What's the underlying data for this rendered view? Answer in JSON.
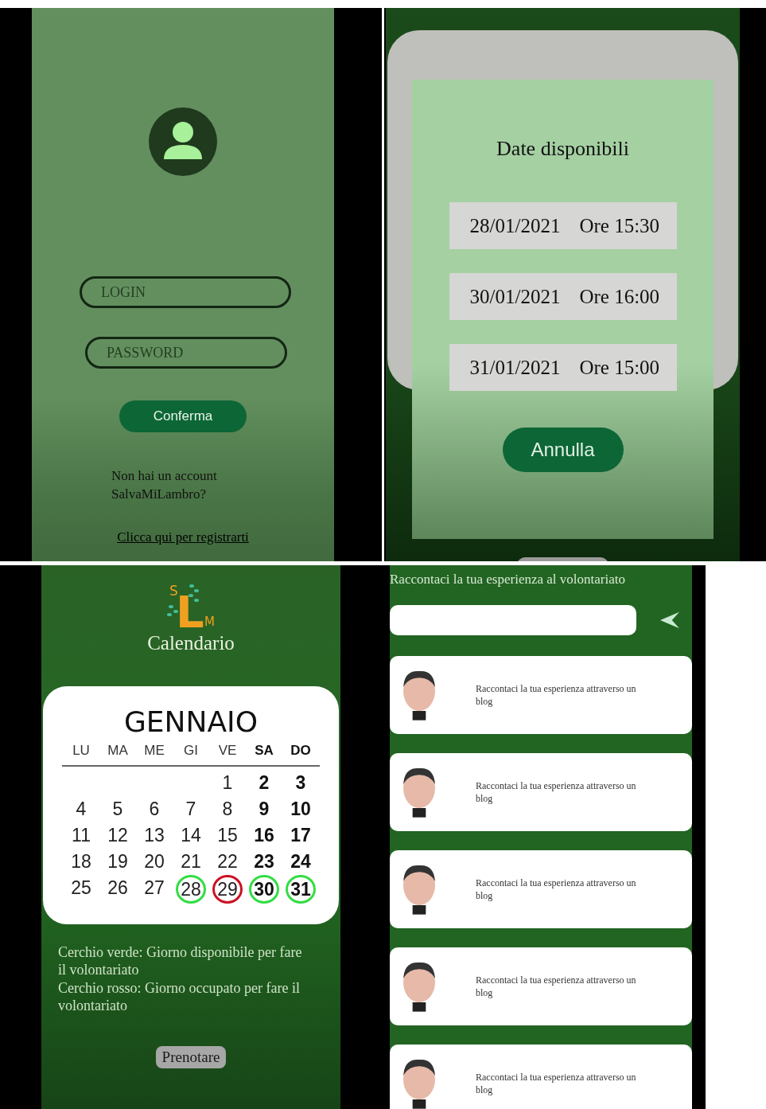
{
  "login_screen": {
    "login_field": {
      "placeholder": "LOGIN"
    },
    "password_field": {
      "placeholder": "PASSWORD"
    },
    "confirm_button": "Conferma",
    "no_account_text": "Non hai un account SalvaMiLambro?",
    "register_link": "Clicca qui per registrarti"
  },
  "dates_dialog": {
    "title": "Date disponibili",
    "slots": [
      {
        "date": "28/01/2021",
        "time": "Ore 15:30"
      },
      {
        "date": "30/01/2021",
        "time": "Ore 16:00"
      },
      {
        "date": "31/01/2021",
        "time": "Ore 15:00"
      }
    ],
    "cancel_button": "Annulla"
  },
  "calendar_screen": {
    "logo": {
      "letters": [
        "S",
        "L",
        "M"
      ]
    },
    "title": "Calendario",
    "month": "GENNAIO",
    "weekdays": [
      {
        "label": "LU",
        "weekend": false
      },
      {
        "label": "MA",
        "weekend": false
      },
      {
        "label": "ME",
        "weekend": false
      },
      {
        "label": "GI",
        "weekend": false
      },
      {
        "label": "VE",
        "weekend": false
      },
      {
        "label": "SA",
        "weekend": true
      },
      {
        "label": "DO",
        "weekend": true
      }
    ],
    "weeks": [
      [
        {
          "day": "1"
        },
        {
          "day": "2"
        },
        {
          "day": "3"
        }
      ],
      [
        {
          "day": "4"
        },
        {
          "day": "5"
        },
        {
          "day": "6"
        },
        {
          "day": "7"
        },
        {
          "day": "8"
        },
        {
          "day": "9"
        },
        {
          "day": "10"
        }
      ],
      [
        {
          "day": "11"
        },
        {
          "day": "12"
        },
        {
          "day": "13"
        },
        {
          "day": "14"
        },
        {
          "day": "15"
        },
        {
          "day": "16"
        },
        {
          "day": "17"
        }
      ],
      [
        {
          "day": "18"
        },
        {
          "day": "19"
        },
        {
          "day": "20"
        },
        {
          "day": "21"
        },
        {
          "day": "22"
        },
        {
          "day": "23"
        },
        {
          "day": "24"
        }
      ],
      [
        {
          "day": "25"
        },
        {
          "day": "26"
        },
        {
          "day": "27"
        },
        {
          "day": "28",
          "color": "#33dd44"
        },
        {
          "day": "29",
          "color": "#cc1122"
        },
        {
          "day": "30",
          "color": "#33dd44"
        },
        {
          "day": "31",
          "color": "#33dd44"
        }
      ]
    ],
    "legend": [
      "Cerchio verde: Giorno disponibile per fare il volontariato",
      "Cerchio rosso: Giorno occupato per fare il volontariato"
    ],
    "book_button": "Prenotare"
  },
  "blog_screen": {
    "heading": "Raccontaci la tua esperienza al volontariato",
    "posts": [
      {
        "text": "Raccontaci la tua esperienza attraverso un blog"
      },
      {
        "text": "Raccontaci la tua esperienza attraverso un blog"
      },
      {
        "text": "Raccontaci la tua esperienza attraverso un blog"
      },
      {
        "text": "Raccontaci la tua esperienza attraverso un blog"
      },
      {
        "text": "Raccontaci la tua esperienza attraverso un blog"
      }
    ]
  }
}
